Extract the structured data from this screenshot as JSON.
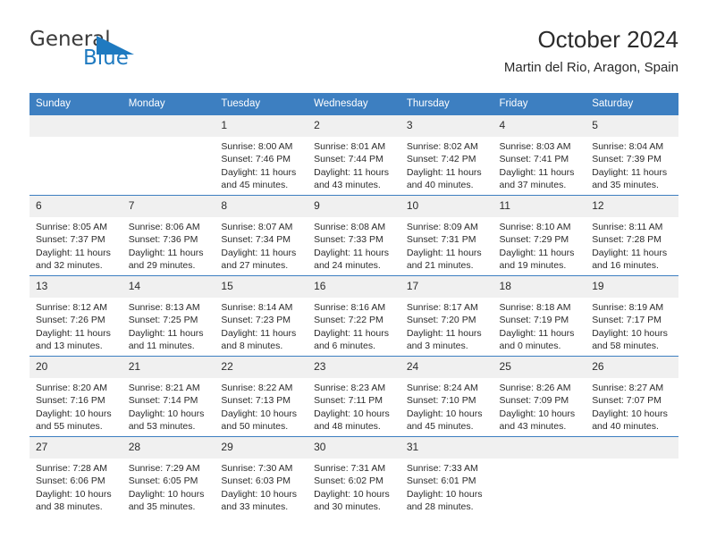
{
  "logo": {
    "word1": "General",
    "word2": "Blue",
    "triangle_color": "#1f7ac0",
    "word1_color": "#3b3b3b",
    "word2_color": "#1f7ac0"
  },
  "header": {
    "title": "October 2024",
    "subtitle": "Martin del Rio, Aragon, Spain"
  },
  "theme": {
    "header_blue": "#3d7fc1",
    "daynum_bg": "#f0f0f0",
    "text": "#2b2b2b"
  },
  "weekdays": [
    "Sunday",
    "Monday",
    "Tuesday",
    "Wednesday",
    "Thursday",
    "Friday",
    "Saturday"
  ],
  "weeks": [
    [
      {
        "day": "",
        "lines": []
      },
      {
        "day": "",
        "lines": []
      },
      {
        "day": "1",
        "lines": [
          "Sunrise: 8:00 AM",
          "Sunset: 7:46 PM",
          "Daylight: 11 hours",
          "and 45 minutes."
        ]
      },
      {
        "day": "2",
        "lines": [
          "Sunrise: 8:01 AM",
          "Sunset: 7:44 PM",
          "Daylight: 11 hours",
          "and 43 minutes."
        ]
      },
      {
        "day": "3",
        "lines": [
          "Sunrise: 8:02 AM",
          "Sunset: 7:42 PM",
          "Daylight: 11 hours",
          "and 40 minutes."
        ]
      },
      {
        "day": "4",
        "lines": [
          "Sunrise: 8:03 AM",
          "Sunset: 7:41 PM",
          "Daylight: 11 hours",
          "and 37 minutes."
        ]
      },
      {
        "day": "5",
        "lines": [
          "Sunrise: 8:04 AM",
          "Sunset: 7:39 PM",
          "Daylight: 11 hours",
          "and 35 minutes."
        ]
      }
    ],
    [
      {
        "day": "6",
        "lines": [
          "Sunrise: 8:05 AM",
          "Sunset: 7:37 PM",
          "Daylight: 11 hours",
          "and 32 minutes."
        ]
      },
      {
        "day": "7",
        "lines": [
          "Sunrise: 8:06 AM",
          "Sunset: 7:36 PM",
          "Daylight: 11 hours",
          "and 29 minutes."
        ]
      },
      {
        "day": "8",
        "lines": [
          "Sunrise: 8:07 AM",
          "Sunset: 7:34 PM",
          "Daylight: 11 hours",
          "and 27 minutes."
        ]
      },
      {
        "day": "9",
        "lines": [
          "Sunrise: 8:08 AM",
          "Sunset: 7:33 PM",
          "Daylight: 11 hours",
          "and 24 minutes."
        ]
      },
      {
        "day": "10",
        "lines": [
          "Sunrise: 8:09 AM",
          "Sunset: 7:31 PM",
          "Daylight: 11 hours",
          "and 21 minutes."
        ]
      },
      {
        "day": "11",
        "lines": [
          "Sunrise: 8:10 AM",
          "Sunset: 7:29 PM",
          "Daylight: 11 hours",
          "and 19 minutes."
        ]
      },
      {
        "day": "12",
        "lines": [
          "Sunrise: 8:11 AM",
          "Sunset: 7:28 PM",
          "Daylight: 11 hours",
          "and 16 minutes."
        ]
      }
    ],
    [
      {
        "day": "13",
        "lines": [
          "Sunrise: 8:12 AM",
          "Sunset: 7:26 PM",
          "Daylight: 11 hours",
          "and 13 minutes."
        ]
      },
      {
        "day": "14",
        "lines": [
          "Sunrise: 8:13 AM",
          "Sunset: 7:25 PM",
          "Daylight: 11 hours",
          "and 11 minutes."
        ]
      },
      {
        "day": "15",
        "lines": [
          "Sunrise: 8:14 AM",
          "Sunset: 7:23 PM",
          "Daylight: 11 hours",
          "and 8 minutes."
        ]
      },
      {
        "day": "16",
        "lines": [
          "Sunrise: 8:16 AM",
          "Sunset: 7:22 PM",
          "Daylight: 11 hours",
          "and 6 minutes."
        ]
      },
      {
        "day": "17",
        "lines": [
          "Sunrise: 8:17 AM",
          "Sunset: 7:20 PM",
          "Daylight: 11 hours",
          "and 3 minutes."
        ]
      },
      {
        "day": "18",
        "lines": [
          "Sunrise: 8:18 AM",
          "Sunset: 7:19 PM",
          "Daylight: 11 hours",
          "and 0 minutes."
        ]
      },
      {
        "day": "19",
        "lines": [
          "Sunrise: 8:19 AM",
          "Sunset: 7:17 PM",
          "Daylight: 10 hours",
          "and 58 minutes."
        ]
      }
    ],
    [
      {
        "day": "20",
        "lines": [
          "Sunrise: 8:20 AM",
          "Sunset: 7:16 PM",
          "Daylight: 10 hours",
          "and 55 minutes."
        ]
      },
      {
        "day": "21",
        "lines": [
          "Sunrise: 8:21 AM",
          "Sunset: 7:14 PM",
          "Daylight: 10 hours",
          "and 53 minutes."
        ]
      },
      {
        "day": "22",
        "lines": [
          "Sunrise: 8:22 AM",
          "Sunset: 7:13 PM",
          "Daylight: 10 hours",
          "and 50 minutes."
        ]
      },
      {
        "day": "23",
        "lines": [
          "Sunrise: 8:23 AM",
          "Sunset: 7:11 PM",
          "Daylight: 10 hours",
          "and 48 minutes."
        ]
      },
      {
        "day": "24",
        "lines": [
          "Sunrise: 8:24 AM",
          "Sunset: 7:10 PM",
          "Daylight: 10 hours",
          "and 45 minutes."
        ]
      },
      {
        "day": "25",
        "lines": [
          "Sunrise: 8:26 AM",
          "Sunset: 7:09 PM",
          "Daylight: 10 hours",
          "and 43 minutes."
        ]
      },
      {
        "day": "26",
        "lines": [
          "Sunrise: 8:27 AM",
          "Sunset: 7:07 PM",
          "Daylight: 10 hours",
          "and 40 minutes."
        ]
      }
    ],
    [
      {
        "day": "27",
        "lines": [
          "Sunrise: 7:28 AM",
          "Sunset: 6:06 PM",
          "Daylight: 10 hours",
          "and 38 minutes."
        ]
      },
      {
        "day": "28",
        "lines": [
          "Sunrise: 7:29 AM",
          "Sunset: 6:05 PM",
          "Daylight: 10 hours",
          "and 35 minutes."
        ]
      },
      {
        "day": "29",
        "lines": [
          "Sunrise: 7:30 AM",
          "Sunset: 6:03 PM",
          "Daylight: 10 hours",
          "and 33 minutes."
        ]
      },
      {
        "day": "30",
        "lines": [
          "Sunrise: 7:31 AM",
          "Sunset: 6:02 PM",
          "Daylight: 10 hours",
          "and 30 minutes."
        ]
      },
      {
        "day": "31",
        "lines": [
          "Sunrise: 7:33 AM",
          "Sunset: 6:01 PM",
          "Daylight: 10 hours",
          "and 28 minutes."
        ]
      },
      {
        "day": "",
        "lines": []
      },
      {
        "day": "",
        "lines": []
      }
    ]
  ]
}
